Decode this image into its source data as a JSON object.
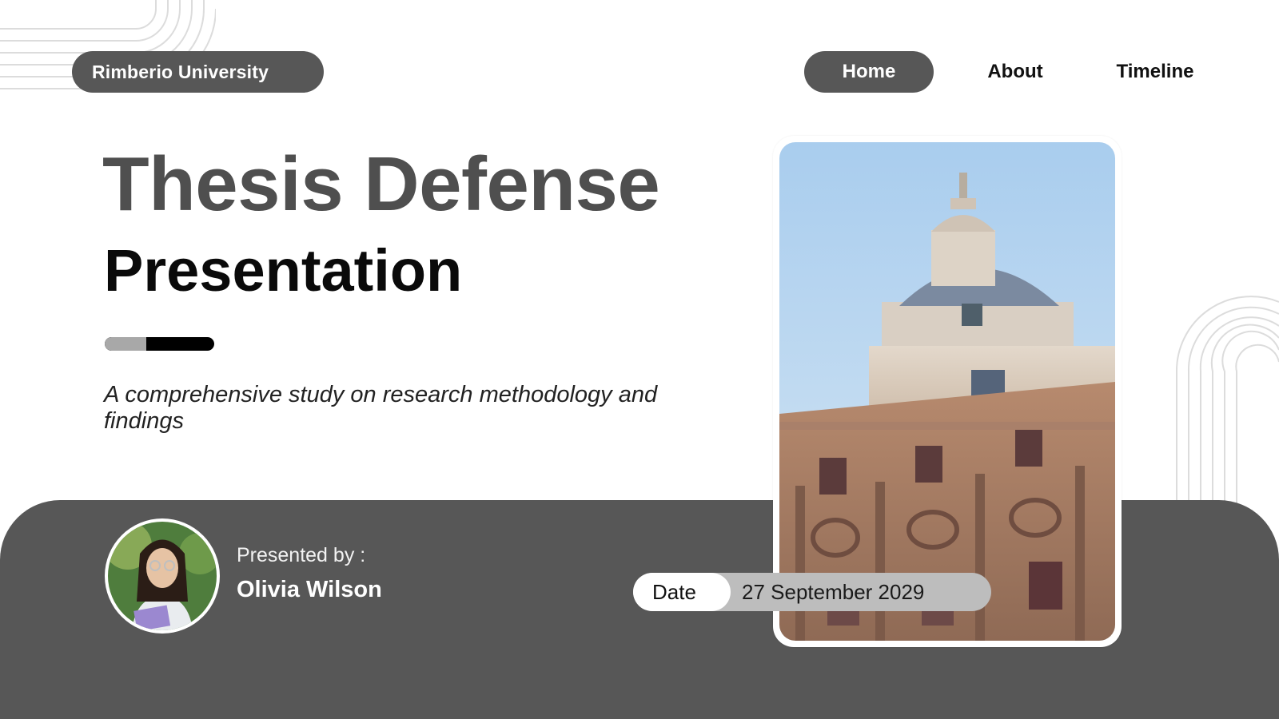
{
  "brand": {
    "name": "Rimberio University"
  },
  "nav": {
    "items": [
      "Home",
      "About",
      "Timeline"
    ],
    "active": "Home"
  },
  "hero": {
    "title": "Thesis Defense",
    "subtitle": "Presentation",
    "description": "A comprehensive study on research methodology and findings"
  },
  "presenter": {
    "label": "Presented by :",
    "name": "Olivia Wilson"
  },
  "date": {
    "label": "Date",
    "value": "27 September 2029"
  },
  "colors": {
    "dark_gray": "#575757",
    "title_gray": "#4f4f4f",
    "light_gray": "#bdbdbd",
    "accent_light": "#a8a8a8"
  },
  "images": {
    "hero_photo": "university-building-photo",
    "avatar": "presenter-photo"
  }
}
